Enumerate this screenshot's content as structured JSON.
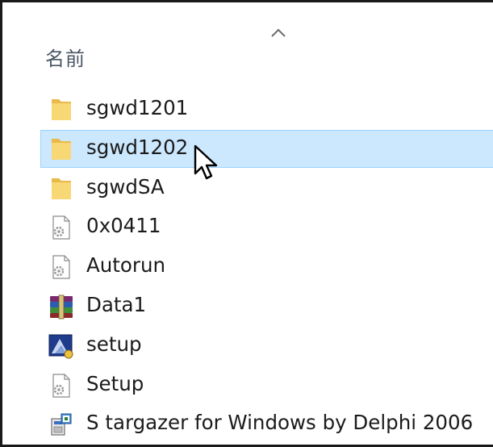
{
  "header": {
    "column_name": "名前",
    "sort_icon": "chevron-up-icon"
  },
  "files": [
    {
      "name": "sgwd1201",
      "icon": "folder-icon",
      "selected": false
    },
    {
      "name": "sgwd1202",
      "icon": "folder-icon",
      "selected": true
    },
    {
      "name": "sgwdSA",
      "icon": "folder-icon",
      "selected": false
    },
    {
      "name": "0x0411",
      "icon": "settings-file-icon",
      "selected": false
    },
    {
      "name": "Autorun",
      "icon": "settings-file-icon",
      "selected": false
    },
    {
      "name": "Data1",
      "icon": "winrar-archive-icon",
      "selected": false
    },
    {
      "name": "setup",
      "icon": "setup-app-icon",
      "selected": false
    },
    {
      "name": "Setup",
      "icon": "settings-file-icon",
      "selected": false
    },
    {
      "name": "S targazer for Windows by Delphi 2006",
      "icon": "installer-icon",
      "selected": false
    }
  ],
  "colors": {
    "selection_fill": "#cce8ff",
    "selection_border": "#99d1ff",
    "folder": "#f8d775"
  }
}
